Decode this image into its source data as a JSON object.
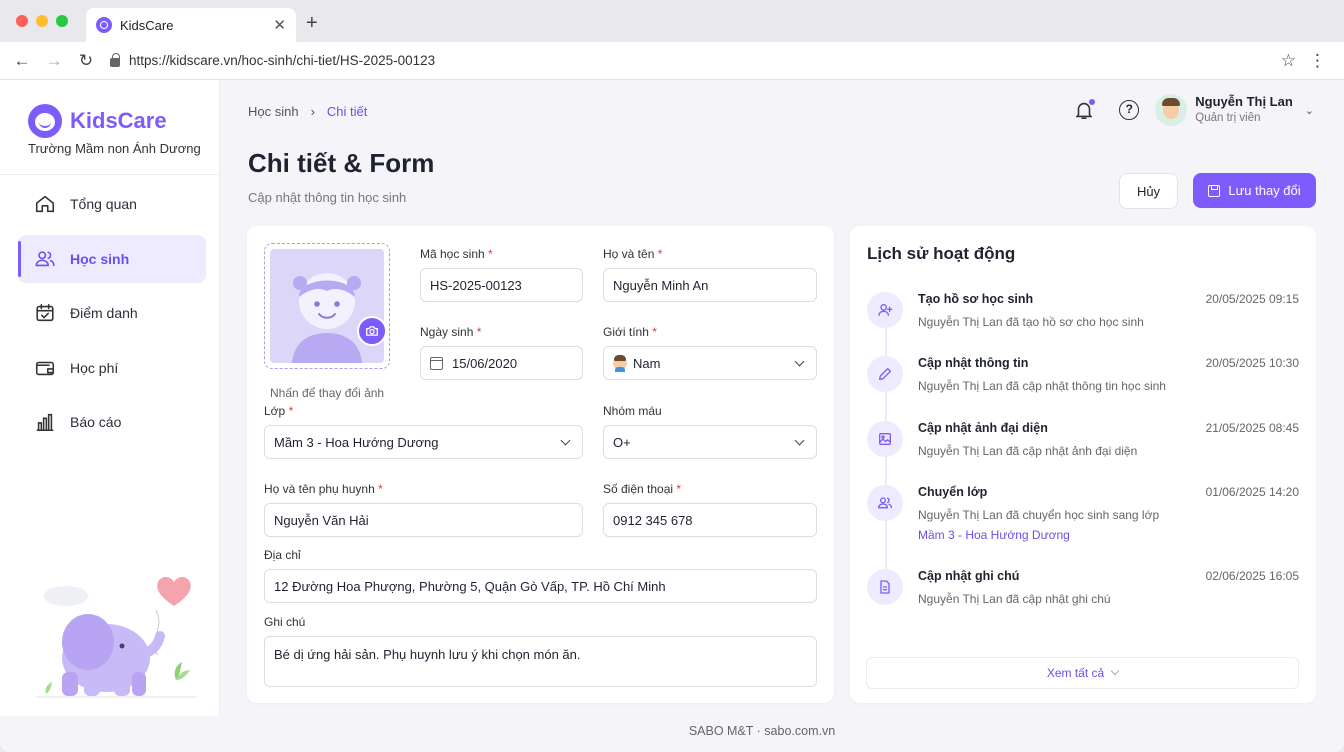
{
  "browser": {
    "tab_title": "KidsCare",
    "url": "https://kidscare.vn/hoc-sinh/chi-tiet/HS-2025-00123"
  },
  "sidebar": {
    "brand": "KidsCare",
    "school": "Trường Mầm non Ánh Dương",
    "items": [
      {
        "label": "Tổng quan",
        "icon": "home-icon"
      },
      {
        "label": "Học sinh",
        "icon": "users-icon",
        "active": true
      },
      {
        "label": "Điểm danh",
        "icon": "calendar-check-icon"
      },
      {
        "label": "Học phí",
        "icon": "wallet-icon"
      },
      {
        "label": "Báo cáo",
        "icon": "bar-chart-icon"
      }
    ]
  },
  "header": {
    "breadcrumb": [
      "Học sinh",
      "Chi tiết"
    ],
    "title": "Chi tiết & Form",
    "subtitle": "Cập nhật thông tin học sinh",
    "user_name": "Nguyễn Thị Lan",
    "user_role": "Quản trị viên",
    "cancel_label": "Hủy",
    "save_label": "Lưu thay đổi"
  },
  "form": {
    "photo_hint": "Nhấn để thay đổi ảnh",
    "student_id": {
      "label": "Mã học sinh",
      "value": "HS-2025-00123"
    },
    "full_name": {
      "label": "Họ và tên",
      "value": "Nguyễn Minh An"
    },
    "dob": {
      "label": "Ngày sinh",
      "value": "15/06/2020"
    },
    "gender": {
      "label": "Giới tính",
      "value": "Nam"
    },
    "class": {
      "label": "Lớp",
      "value": "Mầm 3 - Hoa Hướng Dương"
    },
    "blood": {
      "label": "Nhóm máu",
      "value": "O+"
    },
    "parent": {
      "label": "Họ và tên phụ huynh",
      "value": "Nguyễn Văn Hải"
    },
    "phone": {
      "label": "Số điện thoại",
      "value": "0912 345 678"
    },
    "address": {
      "label": "Địa chỉ",
      "value": "12 Đường Hoa Phượng, Phường 5, Quận Gò Vấp, TP. Hồ Chí Minh"
    },
    "note": {
      "label": "Ghi chú",
      "value": "Bé dị ứng hải sản. Phụ huynh lưu ý khi chọn món ăn."
    }
  },
  "activity": {
    "title": "Lịch sử hoạt động",
    "items": [
      {
        "name": "Tạo hồ sơ học sinh",
        "time": "20/05/2025 09:15",
        "desc": "Nguyễn Thị Lan đã tạo hồ sơ cho học sinh",
        "link": ""
      },
      {
        "name": "Cập nhật thông tin",
        "time": "20/05/2025 10:30",
        "desc": "Nguyễn Thị Lan đã cập nhật thông tin học sinh",
        "link": ""
      },
      {
        "name": "Cập nhật ảnh đại diện",
        "time": "21/05/2025 08:45",
        "desc": "Nguyễn Thị Lan đã cập nhật ảnh đại diện",
        "link": ""
      },
      {
        "name": "Chuyển lớp",
        "time": "01/06/2025 14:20",
        "desc": "Nguyễn Thị Lan đã chuyển học sinh sang lớp",
        "link": "Mầm 3 - Hoa Hướng Dương"
      },
      {
        "name": "Cập nhật ghi chú",
        "time": "02/06/2025 16:05",
        "desc": "Nguyễn Thị Lan đã cập nhật ghi chú",
        "link": ""
      }
    ],
    "see_all": "Xem tất cả"
  },
  "footer": "SABO M&T · sabo.com.vn",
  "colors": {
    "accent": "#7c5cfa",
    "accent_light": "#efebff",
    "required": "#e53935"
  }
}
